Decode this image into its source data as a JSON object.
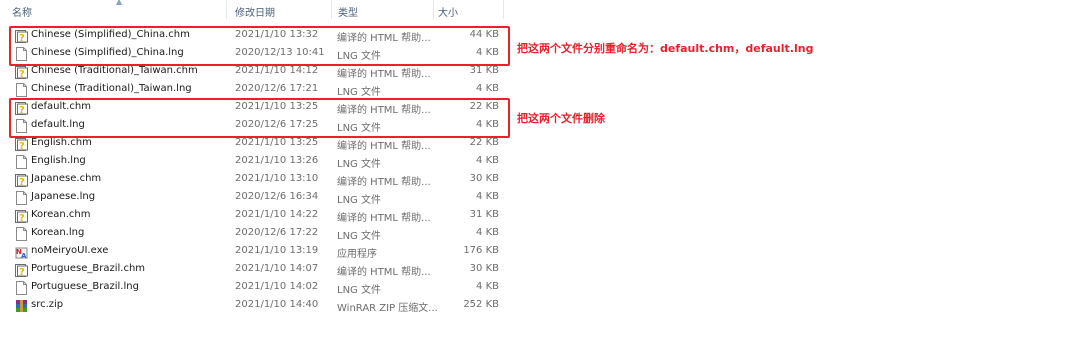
{
  "columns": {
    "name": "名称",
    "date": "修改日期",
    "type": "类型",
    "size": "大小"
  },
  "files": [
    {
      "name": "Chinese (Simplified)_China.chm",
      "date": "2021/1/10 13:32",
      "type": "编译的 HTML 帮助...",
      "size": "44 KB",
      "icon": "chm-help-file-icon"
    },
    {
      "name": "Chinese (Simplified)_China.lng",
      "date": "2020/12/13 10:41",
      "type": "LNG 文件",
      "size": "4 KB",
      "icon": "blank-file-icon"
    },
    {
      "name": "Chinese (Traditional)_Taiwan.chm",
      "date": "2021/1/10 14:12",
      "type": "编译的 HTML 帮助...",
      "size": "31 KB",
      "icon": "chm-help-file-icon"
    },
    {
      "name": "Chinese (Traditional)_Taiwan.lng",
      "date": "2020/12/6 17:21",
      "type": "LNG 文件",
      "size": "4 KB",
      "icon": "blank-file-icon"
    },
    {
      "name": "default.chm",
      "date": "2021/1/10 13:25",
      "type": "编译的 HTML 帮助...",
      "size": "22 KB",
      "icon": "chm-help-file-icon"
    },
    {
      "name": "default.lng",
      "date": "2020/12/6 17:25",
      "type": "LNG 文件",
      "size": "4 KB",
      "icon": "blank-file-icon"
    },
    {
      "name": "English.chm",
      "date": "2021/1/10 13:25",
      "type": "编译的 HTML 帮助...",
      "size": "22 KB",
      "icon": "chm-help-file-icon"
    },
    {
      "name": "English.lng",
      "date": "2021/1/10 13:26",
      "type": "LNG 文件",
      "size": "4 KB",
      "icon": "blank-file-icon"
    },
    {
      "name": "Japanese.chm",
      "date": "2021/1/10 13:10",
      "type": "编译的 HTML 帮助...",
      "size": "30 KB",
      "icon": "chm-help-file-icon"
    },
    {
      "name": "Japanese.lng",
      "date": "2020/12/6 16:34",
      "type": "LNG 文件",
      "size": "4 KB",
      "icon": "blank-file-icon"
    },
    {
      "name": "Korean.chm",
      "date": "2021/1/10 14:22",
      "type": "编译的 HTML 帮助...",
      "size": "31 KB",
      "icon": "chm-help-file-icon"
    },
    {
      "name": "Korean.lng",
      "date": "2020/12/6 17:22",
      "type": "LNG 文件",
      "size": "4 KB",
      "icon": "blank-file-icon"
    },
    {
      "name": "noMeiryoUI.exe",
      "date": "2021/1/10 13:19",
      "type": "应用程序",
      "size": "176 KB",
      "icon": "exe-app-icon"
    },
    {
      "name": "Portuguese_Brazil.chm",
      "date": "2021/1/10 14:07",
      "type": "编译的 HTML 帮助...",
      "size": "30 KB",
      "icon": "chm-help-file-icon"
    },
    {
      "name": "Portuguese_Brazil.lng",
      "date": "2021/1/10 14:02",
      "type": "LNG 文件",
      "size": "4 KB",
      "icon": "blank-file-icon"
    },
    {
      "name": "src.zip",
      "date": "2021/1/10 14:40",
      "type": "WinRAR ZIP 压缩文...",
      "size": "252 KB",
      "icon": "winrar-archive-icon"
    }
  ],
  "annotations": {
    "rename": "把这两个文件分别重命名为：default.chm，default.lng",
    "delete": "把这两个文件删除"
  },
  "colors": {
    "annotation": "#e8212d",
    "header_text": "#4c607a",
    "meta_text": "#6d6d6d"
  }
}
